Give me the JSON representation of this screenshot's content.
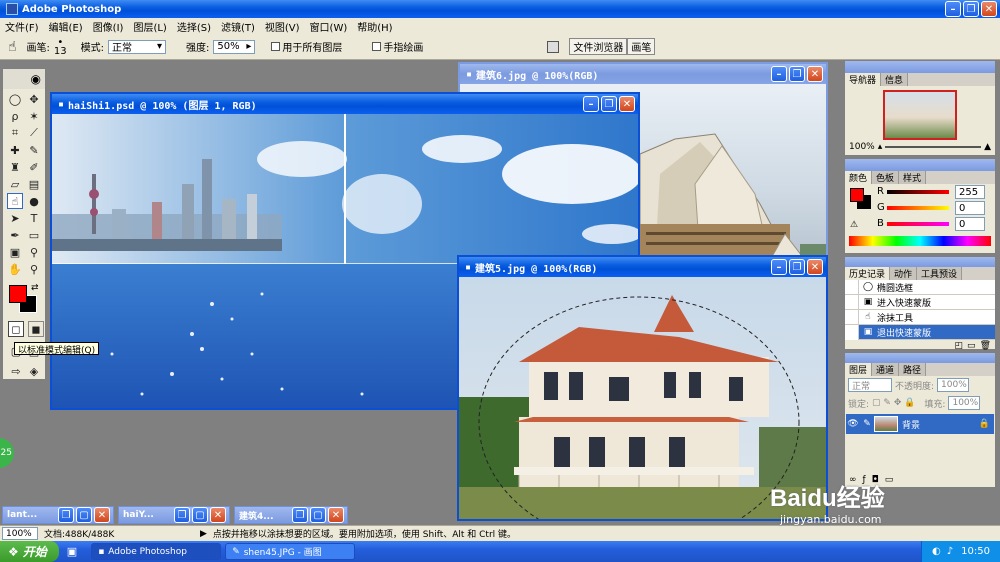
{
  "app": {
    "title": "Adobe Photoshop"
  },
  "menu": [
    "文件(F)",
    "编辑(E)",
    "图像(I)",
    "图层(L)",
    "选择(S)",
    "滤镜(T)",
    "视图(V)",
    "窗口(W)",
    "帮助(H)"
  ],
  "options": {
    "brush_label": "画笔:",
    "brush_size": "13",
    "mode_label": "模式:",
    "mode_value": "正常",
    "strength_label": "强度:",
    "strength_value": "50%",
    "all_layers": "用于所有图层",
    "finger_paint": "手指绘画",
    "tab_browser": "文件浏览器",
    "tab_brush": "画笔"
  },
  "windows": {
    "haishi": {
      "title": "haiShi1.psd @ 100% (图层 1, RGB)"
    },
    "jz6": {
      "title": "建筑6.jpg @ 100%(RGB)"
    },
    "jz5": {
      "title": "建筑5.jpg @ 100%(RGB)"
    }
  },
  "tooltip": "以标准模式编辑(Q)",
  "minimized": [
    "lant...",
    "haiY...",
    "建筑4..."
  ],
  "navigator": {
    "tabs": [
      "导航器",
      "信息"
    ],
    "zoom": "100%"
  },
  "color": {
    "tabs": [
      "颜色",
      "色板",
      "样式"
    ],
    "r_label": "R",
    "g_label": "G",
    "b_label": "B",
    "r": "255",
    "g": "0",
    "b": "0",
    "fg": "#ff0000"
  },
  "history": {
    "tabs": [
      "历史记录",
      "动作",
      "工具预设"
    ],
    "items": [
      "椭圆选框",
      "进入快速蒙版",
      "涂抹工具",
      "退出快速蒙版"
    ]
  },
  "layers": {
    "tabs": [
      "图层",
      "通道",
      "路径"
    ],
    "mode": "正常",
    "opacity_label": "不透明度:",
    "opacity": "100%",
    "lock_label": "锁定:",
    "fill_label": "填充:",
    "fill": "100%",
    "layer_name": "背景"
  },
  "status": {
    "zoom": "100%",
    "doc": "文档:488K/488K",
    "hint": "点按并拖移以涂抹想要的区域。要用附加选项，使用 Shift、Alt 和 Ctrl 键。"
  },
  "taskbar": {
    "start": "开始",
    "tasks": [
      "Adobe Photoshop",
      "shen45.JPG - 画图"
    ],
    "clock": "10:50"
  },
  "watermark": {
    "text": "Baidu经验",
    "url": "jingyan.baidu.com"
  },
  "badge": "25"
}
